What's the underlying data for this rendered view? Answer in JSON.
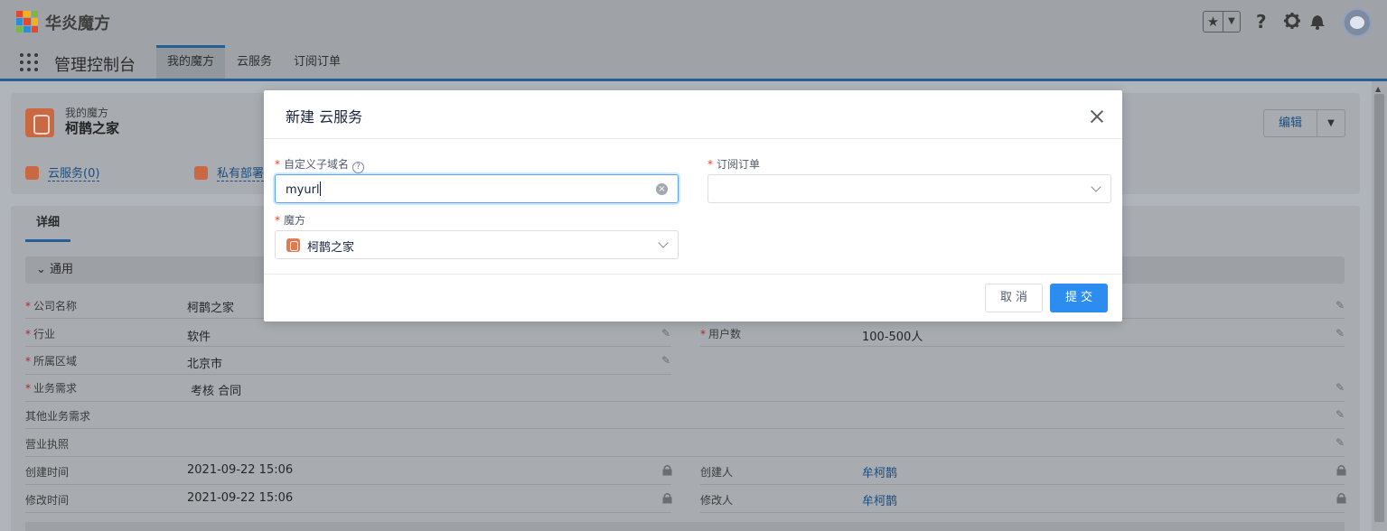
{
  "header": {
    "brand": "华炎魔方",
    "logo_colors": [
      "#e2492f",
      "#f5b11a",
      "#7ab648",
      "#2b8ed6",
      "#e2492f",
      "#f5b11a",
      "#7ab648",
      "#2b8ed6",
      "#e2492f"
    ],
    "icons": [
      "star-icon",
      "chevron-down-icon",
      "help-icon",
      "gear-icon",
      "bell-icon",
      "avatar"
    ]
  },
  "nav": {
    "app_name": "管理控制台",
    "tabs": [
      "我的魔方",
      "云服务",
      "订阅订单"
    ],
    "active_tab": "我的魔方"
  },
  "record": {
    "type": "我的魔方",
    "title": "柯鹊之家",
    "edit_label": "编辑",
    "related": [
      "云服务(0)",
      "私有部署"
    ],
    "detail_tab": "详细",
    "section": "通用"
  },
  "fields": {
    "company_label": "公司名称",
    "company_value": "柯鹊之家",
    "industry_label": "行业",
    "industry_value": "软件",
    "users_label": "用户数",
    "users_value": "100-500人",
    "region_label": "所属区域",
    "region_value": "北京市",
    "needs_label": "业务需求",
    "needs_value": "考核 合同",
    "other_needs_label": "其他业务需求",
    "license_label": "营业执照",
    "created_label": "创建时间",
    "created_value": "2021-09-22 15:06",
    "creator_label": "创建人",
    "creator_value": "牟柯鹊",
    "modified_label": "修改时间",
    "modified_value": "2021-09-22 15:06",
    "modifier_label": "修改人",
    "modifier_value": "牟柯鹊"
  },
  "modal": {
    "title": "新建 云服务",
    "subdomain_label": "自定义子域名",
    "subdomain_value": "myurl",
    "order_label": "订阅订单",
    "order_value": "",
    "space_label": "魔方",
    "space_value": "柯鹊之家",
    "cancel_label": "取消",
    "submit_label": "提交",
    "accent_color": "#2d8cf0"
  }
}
